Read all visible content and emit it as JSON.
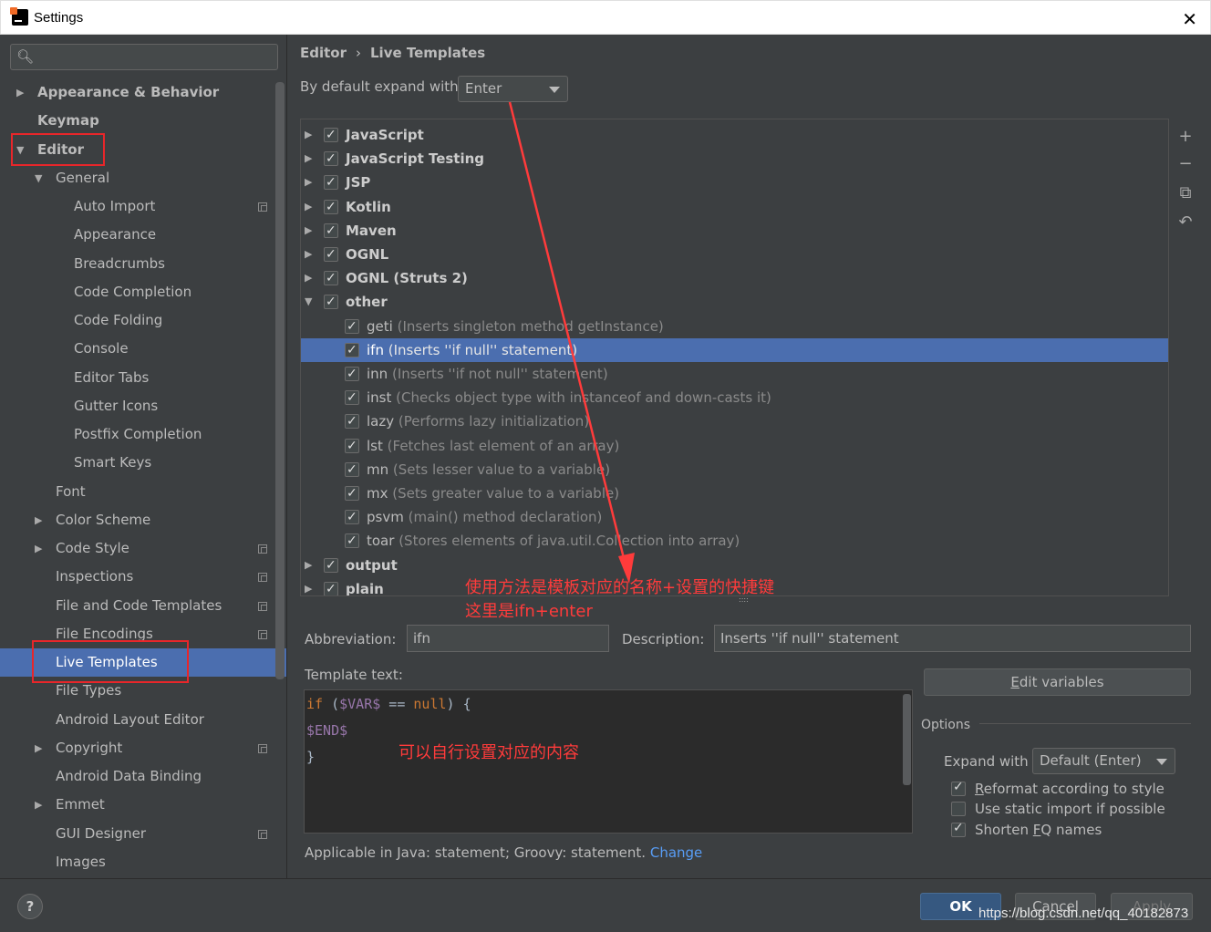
{
  "window": {
    "title": "Settings",
    "close_glyph": "✕"
  },
  "sidebar": {
    "search_placeholder": "",
    "items": [
      {
        "label": "Appearance & Behavior",
        "arrow": "▶",
        "level": 0,
        "bold": true
      },
      {
        "label": "Keymap",
        "arrow": "",
        "level": 0,
        "bold": true
      },
      {
        "label": "Editor",
        "arrow": "▼",
        "level": 0,
        "bold": true
      },
      {
        "label": "General",
        "arrow": "▼",
        "level": 1
      },
      {
        "label": "Auto Import",
        "arrow": "",
        "level": 2,
        "copy": true
      },
      {
        "label": "Appearance",
        "arrow": "",
        "level": 2
      },
      {
        "label": "Breadcrumbs",
        "arrow": "",
        "level": 2
      },
      {
        "label": "Code Completion",
        "arrow": "",
        "level": 2
      },
      {
        "label": "Code Folding",
        "arrow": "",
        "level": 2
      },
      {
        "label": "Console",
        "arrow": "",
        "level": 2
      },
      {
        "label": "Editor Tabs",
        "arrow": "",
        "level": 2
      },
      {
        "label": "Gutter Icons",
        "arrow": "",
        "level": 2
      },
      {
        "label": "Postfix Completion",
        "arrow": "",
        "level": 2
      },
      {
        "label": "Smart Keys",
        "arrow": "",
        "level": 2
      },
      {
        "label": "Font",
        "arrow": "",
        "level": 1
      },
      {
        "label": "Color Scheme",
        "arrow": "▶",
        "level": 1
      },
      {
        "label": "Code Style",
        "arrow": "▶",
        "level": 1,
        "copy": true
      },
      {
        "label": "Inspections",
        "arrow": "",
        "level": 1,
        "copy": true
      },
      {
        "label": "File and Code Templates",
        "arrow": "",
        "level": 1,
        "copy": true
      },
      {
        "label": "File Encodings",
        "arrow": "",
        "level": 1,
        "copy": true
      },
      {
        "label": "Live Templates",
        "arrow": "",
        "level": 1,
        "selected": true
      },
      {
        "label": "File Types",
        "arrow": "",
        "level": 1
      },
      {
        "label": "Android Layout Editor",
        "arrow": "",
        "level": 1
      },
      {
        "label": "Copyright",
        "arrow": "▶",
        "level": 1,
        "copy": true
      },
      {
        "label": "Android Data Binding",
        "arrow": "",
        "level": 1
      },
      {
        "label": "Emmet",
        "arrow": "▶",
        "level": 1
      },
      {
        "label": "GUI Designer",
        "arrow": "",
        "level": 1,
        "copy": true
      },
      {
        "label": "Images",
        "arrow": "",
        "level": 1
      }
    ]
  },
  "breadcrumb": {
    "parent": "Editor",
    "separator": "›",
    "current": "Live Templates"
  },
  "expand_default": {
    "label": "By default expand with",
    "value": "Enter"
  },
  "templates": [
    {
      "name": "JavaScript",
      "desc": "",
      "group": true,
      "arrow": "▶"
    },
    {
      "name": "JavaScript Testing",
      "desc": "",
      "group": true,
      "arrow": "▶"
    },
    {
      "name": "JSP",
      "desc": "",
      "group": true,
      "arrow": "▶"
    },
    {
      "name": "Kotlin",
      "desc": "",
      "group": true,
      "arrow": "▶"
    },
    {
      "name": "Maven",
      "desc": "",
      "group": true,
      "arrow": "▶"
    },
    {
      "name": "OGNL",
      "desc": "",
      "group": true,
      "arrow": "▶"
    },
    {
      "name": "OGNL (Struts 2)",
      "desc": "",
      "group": true,
      "arrow": "▶"
    },
    {
      "name": "other",
      "desc": "",
      "group": true,
      "arrow": "▼"
    },
    {
      "name": "geti",
      "desc": "(Inserts singleton method getInstance)",
      "group": false
    },
    {
      "name": "ifn",
      "desc": "(Inserts ''if null'' statement)",
      "group": false,
      "selected": true
    },
    {
      "name": "inn",
      "desc": "(Inserts ''if not null'' statement)",
      "group": false
    },
    {
      "name": "inst",
      "desc": "(Checks object type with instanceof and down-casts it)",
      "group": false
    },
    {
      "name": "lazy",
      "desc": "(Performs lazy initialization)",
      "group": false
    },
    {
      "name": "lst",
      "desc": "(Fetches last element of an array)",
      "group": false
    },
    {
      "name": "mn",
      "desc": "(Sets lesser value to a variable)",
      "group": false
    },
    {
      "name": "mx",
      "desc": "(Sets greater value to a variable)",
      "group": false
    },
    {
      "name": "psvm",
      "desc": "(main() method declaration)",
      "group": false
    },
    {
      "name": "toar",
      "desc": "(Stores elements of java.util.Collection into array)",
      "group": false
    },
    {
      "name": "output",
      "desc": "",
      "group": true,
      "arrow": "▶"
    },
    {
      "name": "plain",
      "desc": "",
      "group": true,
      "arrow": "▶"
    }
  ],
  "tools": {
    "add": "+",
    "remove": "−",
    "copy": "⧉",
    "restore": "↶"
  },
  "annotations": {
    "usage_line1": "使用方法是模板对应的名称+设置的快捷键",
    "usage_line2": "这里是ifn+enter",
    "content_note": "可以自行设置对应的内容",
    "splitter": "::::"
  },
  "details": {
    "abbreviation_label": "Abbreviation:",
    "abbreviation_value": "ifn",
    "description_label": "Description:",
    "description_value": "Inserts ''if null'' statement",
    "template_text_label": "Template text:",
    "code": {
      "l1_kw1": "if",
      "l1_open": " (",
      "l1_var": "$VAR$",
      "l1_op": " == ",
      "l1_kw2": "null",
      "l1_close": ") {",
      "l2_var": "$END$",
      "l3": "}"
    },
    "edit_variables_prefix": "E",
    "edit_variables_rest": "dit variables",
    "options_label": "Options",
    "expand_with_label": "Expand with",
    "expand_with_value": "Default (Enter)",
    "reformat_prefix": "R",
    "reformat_rest": "eformat according to style",
    "static_import": "Use static import if possible",
    "shorten_prefix": "Shorten ",
    "shorten_u": "F",
    "shorten_rest": "Q names",
    "applicable_text": "Applicable in Java: statement; Groovy: statement.",
    "change_link": "Change"
  },
  "footer": {
    "help": "?",
    "ok": "OK",
    "cancel": "Cancel",
    "apply": "Apply",
    "watermark": "https://blog.csdn.net/qq_40182873"
  },
  "colors": {
    "selection": "#4b6eaf",
    "annotation": "#ff3b3b",
    "link": "#589df6"
  }
}
